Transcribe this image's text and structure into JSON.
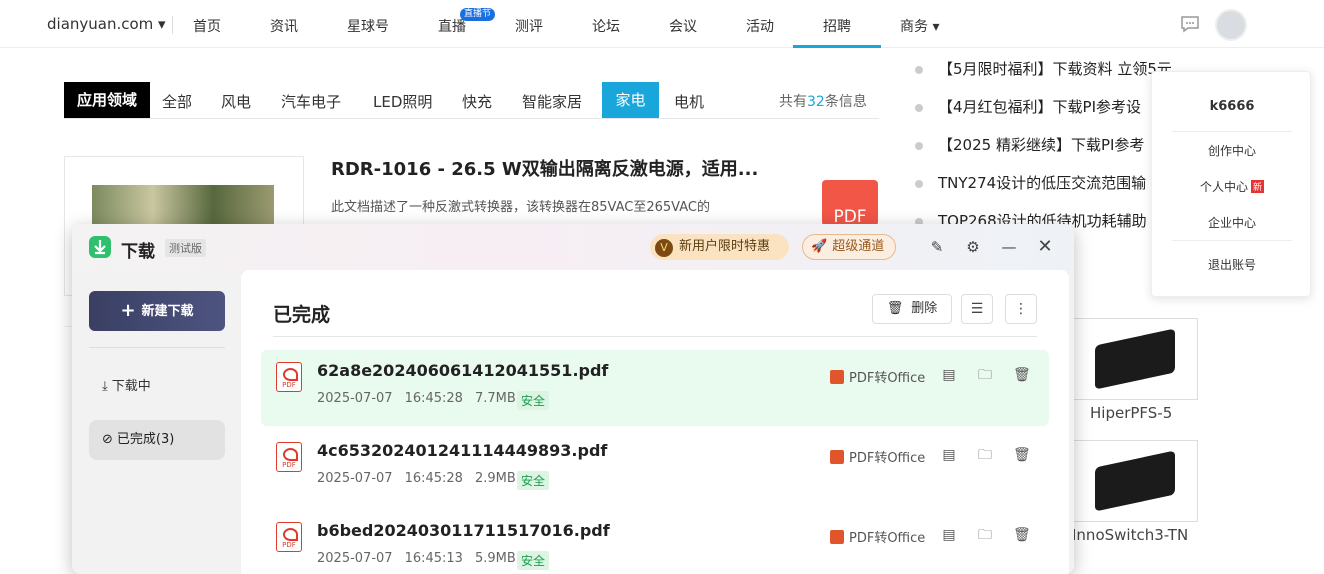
{
  "topnav": {
    "brand": "dianyuan.com ▾",
    "items": [
      "首页",
      "资讯",
      "星球号",
      "直播",
      "测评",
      "论坛",
      "会议",
      "活动",
      "招聘",
      "商务 ▾"
    ],
    "live_badge": "直播节"
  },
  "categories": {
    "heading": "应用领域",
    "items": [
      "全部",
      "风电",
      "汽车电子",
      "LED照明",
      "快充",
      "智能家居"
    ],
    "active": "家电",
    "after": "电机",
    "total_prefix": "共有",
    "total_count": "32",
    "total_suffix": "条信息"
  },
  "article": {
    "title": "RDR-1016 - 26.5 W双输出隔离反激电源，适用...",
    "desc": "此文档描述了一种反激式转换器，该转换器在85VAC至265VAC的",
    "pdf_label": "PDF"
  },
  "right_list": [
    "【5月限时福利】下载资料 立领5元",
    "【4月红包福利】下载PI参考设",
    "【2025 精彩继续】下载PI参考",
    "TNY274设计的低压交流范围输",
    "TOP268设计的低待机功耗辅助"
  ],
  "products": [
    "HiperPFS-5",
    "InnoSwitch3-TN"
  ],
  "user_menu": {
    "username": "k6666",
    "items": [
      "创作中心",
      "个人中心",
      "企业中心",
      "退出账号"
    ],
    "new_tag": "新"
  },
  "download": {
    "title": "下载",
    "beta": "测试版",
    "promo1": "新用户限时特惠",
    "promo2": "超级通道",
    "new_download": "新建下载",
    "side_downloading": "下载中",
    "side_completed": "已完成(3)",
    "section_title": "已完成",
    "delete_label": "删除",
    "convert_label": "PDF转Office",
    "safe_label": "安全",
    "files": [
      {
        "name": "62a8e202406061412041551.pdf",
        "date": "2025-07-07",
        "time": "16:45:28",
        "size": "7.7MB"
      },
      {
        "name": "4c65320240124111444989 3.pdf",
        "date": "2025-07-07",
        "time": "16:45:28",
        "size": "2.9MB"
      },
      {
        "name": "b6bed202403011711517016.pdf",
        "date": "2025-07-07",
        "time": "16:45:13",
        "size": "5.9MB"
      }
    ]
  }
}
